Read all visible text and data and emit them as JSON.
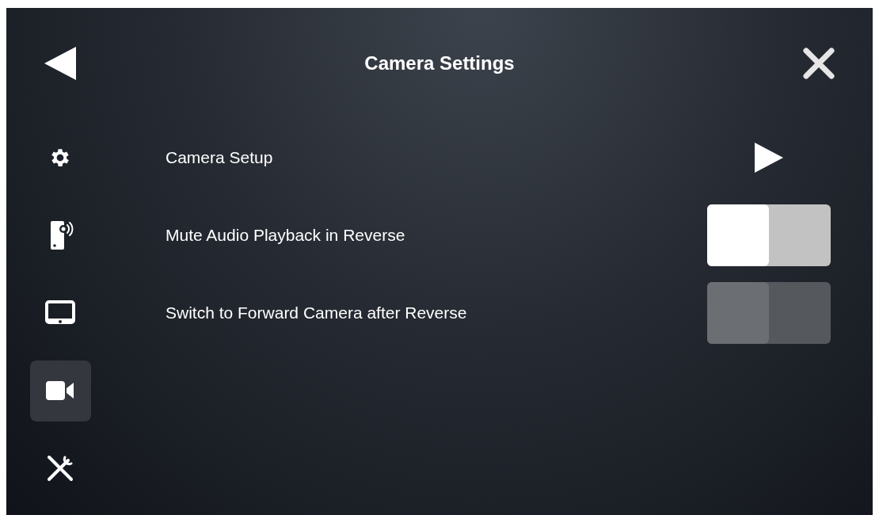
{
  "header": {
    "title": "Camera Settings"
  },
  "sidebar": {
    "items": [
      {
        "kind": "gear",
        "selected": false
      },
      {
        "kind": "phone",
        "selected": false
      },
      {
        "kind": "display",
        "selected": false
      },
      {
        "kind": "camera",
        "selected": true
      },
      {
        "kind": "tools",
        "selected": false
      }
    ]
  },
  "rows": [
    {
      "kind": "link",
      "label": "Camera Setup"
    },
    {
      "kind": "toggle",
      "label": "Mute Audio Playback in Reverse",
      "on": true
    },
    {
      "kind": "toggle",
      "label": "Switch to Forward Camera after Reverse",
      "on": false
    }
  ]
}
